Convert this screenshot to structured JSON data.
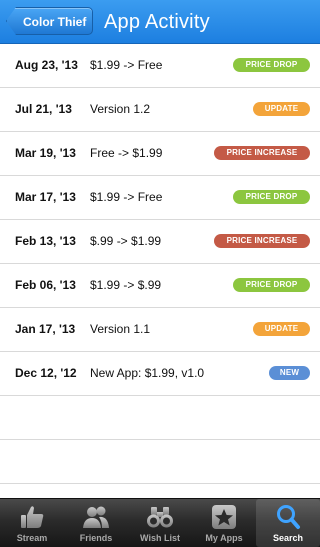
{
  "navbar": {
    "back_label": "Color Thief",
    "title": "App Activity"
  },
  "activity": [
    {
      "date": "Aug 23, '13",
      "change": "$1.99 -> Free",
      "badge": "PRICE DROP",
      "badge_type": "price-drop"
    },
    {
      "date": "Jul 21, '13",
      "change": "Version 1.2",
      "badge": "UPDATE",
      "badge_type": "update"
    },
    {
      "date": "Mar 19, '13",
      "change": "Free -> $1.99",
      "badge": "PRICE INCREASE",
      "badge_type": "price-increase"
    },
    {
      "date": "Mar 17, '13",
      "change": "$1.99 -> Free",
      "badge": "PRICE DROP",
      "badge_type": "price-drop"
    },
    {
      "date": "Feb 13, '13",
      "change": "$.99 -> $1.99",
      "badge": "PRICE INCREASE",
      "badge_type": "price-increase"
    },
    {
      "date": "Feb 06, '13",
      "change": "$1.99 -> $.99",
      "badge": "PRICE DROP",
      "badge_type": "price-drop"
    },
    {
      "date": "Jan 17, '13",
      "change": "Version 1.1",
      "badge": "UPDATE",
      "badge_type": "update"
    },
    {
      "date": "Dec 12, '12",
      "change": "New App: $1.99, v1.0",
      "badge": "NEW",
      "badge_type": "new"
    }
  ],
  "badge_colors": {
    "price-drop": "#8cc63f",
    "update": "#f3a43a",
    "price-increase": "#c45a46",
    "new": "#5b8fd6"
  },
  "tabbar": {
    "tabs": [
      {
        "label": "Stream",
        "icon": "thumbs-up-icon",
        "active": false
      },
      {
        "label": "Friends",
        "icon": "friends-icon",
        "active": false
      },
      {
        "label": "Wish List",
        "icon": "binoculars-icon",
        "active": false
      },
      {
        "label": "My Apps",
        "icon": "star-box-icon",
        "active": false
      },
      {
        "label": "Search",
        "icon": "search-icon",
        "active": true
      }
    ]
  }
}
